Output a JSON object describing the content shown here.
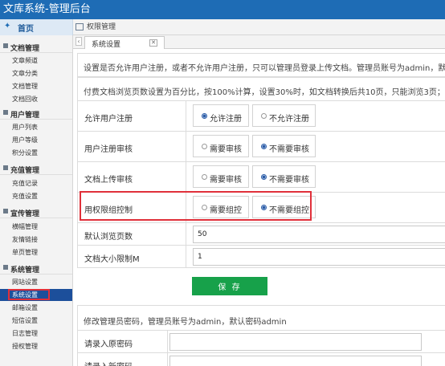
{
  "app": {
    "title": "文库系统-管理后台"
  },
  "nav": {
    "home_icon": "home-icon",
    "home_label": "首页",
    "perm_label": "权限管理"
  },
  "tabs": {
    "prev": "‹",
    "current": "系统设置",
    "close": "✕"
  },
  "sidebar": {
    "groups": [
      {
        "label": "文档管理",
        "items": [
          "文章频道",
          "文章分类",
          "文档管理",
          "文档回收"
        ]
      },
      {
        "label": "用户管理",
        "items": [
          "用户列表",
          "用户等级",
          "积分设置"
        ]
      },
      {
        "label": "充值管理",
        "items": [
          "充值记录",
          "充值设置"
        ]
      },
      {
        "label": "宣传管理",
        "items": [
          "横幅管理",
          "友情链接",
          "单页管理"
        ]
      },
      {
        "label": "系统管理",
        "items": [
          "网站设置",
          "系统设置",
          "邮箱设置",
          "短信设置",
          "日志管理",
          "授权管理"
        ]
      }
    ],
    "active_item": "系统设置"
  },
  "settings": {
    "info1": "设置是否允许用户注册，或者不允许用户注册，只可以管理员登录上传文档。管理员账号为admin，默认",
    "info2": "付费文档浏览页数设置为百分比，按100%计算，设置30%时，如文档转换后共10页，只能浏览3页；如",
    "rows": [
      {
        "label": "允许用户注册",
        "options": [
          "允许注册",
          "不允许注册"
        ],
        "selected": 0
      },
      {
        "label": "用户注册审核",
        "options": [
          "需要审核",
          "不需要审核"
        ],
        "selected": 1
      },
      {
        "label": "文档上传审核",
        "options": [
          "需要审核",
          "不需要审核"
        ],
        "selected": 1
      },
      {
        "label": "用权限组控制",
        "options": [
          "需要组控",
          "不需要组控"
        ],
        "selected": 1
      }
    ],
    "browse_label": "默认浏览页数",
    "browse_value": "50",
    "size_label": "文档大小限制M",
    "size_value": "1",
    "save_label": "保 存"
  },
  "password": {
    "title": "修改管理员密码，管理员账号为admin，默认密码admin",
    "old_label": "请录入原密码",
    "new_label": "请录入新密码"
  },
  "colors": {
    "header": "#1e6cb5",
    "active": "#1c4f9b",
    "save": "#17a14a",
    "highlight": "#e0303a"
  }
}
